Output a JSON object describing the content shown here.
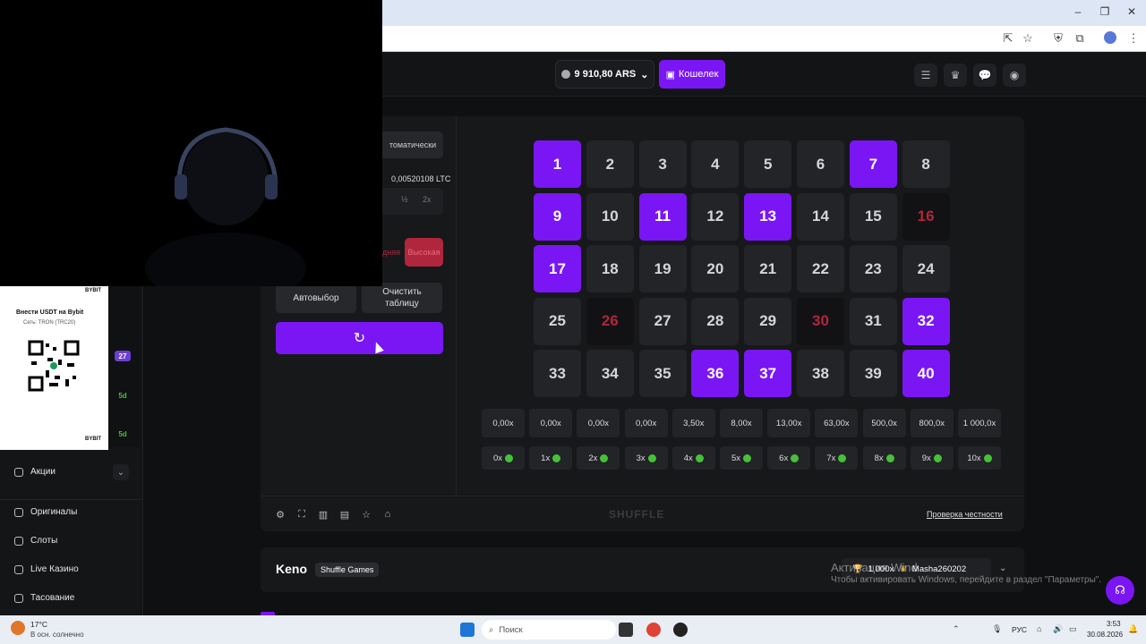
{
  "header": {
    "balance": "9 910,80 ARS",
    "wallet_label": "Кошелек"
  },
  "controls": {
    "mode_tab": "томатически",
    "bet_amount_crypto": "0,00520108 LTC",
    "half_label": "½",
    "double_label": "2x",
    "risk_medium": "дняя",
    "risk_high": "Высокая",
    "autoselect_label": "Автовыбор",
    "clear_label_1": "Очистить",
    "clear_label_2": "таблицу"
  },
  "grid": {
    "numbers": [
      1,
      2,
      3,
      4,
      5,
      6,
      7,
      8,
      9,
      10,
      11,
      12,
      13,
      14,
      15,
      16,
      17,
      18,
      19,
      20,
      21,
      22,
      23,
      24,
      25,
      26,
      27,
      28,
      29,
      30,
      31,
      32,
      33,
      34,
      35,
      36,
      37,
      38,
      39,
      40
    ],
    "selected": [
      1,
      7,
      9,
      11,
      13,
      17,
      32,
      36,
      37,
      40
    ],
    "hits_dark": [
      16,
      26,
      30
    ]
  },
  "payouts": [
    "0,00x",
    "0,00x",
    "0,00x",
    "0,00x",
    "3,50x",
    "8,00x",
    "13,00x",
    "63,00x",
    "500,0x",
    "800,0x",
    "1 000,0x"
  ],
  "hit_counts": [
    "0x",
    "1x",
    "2x",
    "3x",
    "4x",
    "5x",
    "6x",
    "7x",
    "8x",
    "9x",
    "10x"
  ],
  "footer": {
    "brand": "SHUFFLE",
    "fairness_label": "Проверка честности"
  },
  "info": {
    "game_title": "Keno",
    "provider": "Shuffle Games",
    "top_multiplier": "1 000x",
    "top_user": "Masha260202",
    "watermark_1": "Активация Wind",
    "watermark_2": "Чтобы активировать Windows, перейдите в раздел \"Параметры\"."
  },
  "sidebar": {
    "badge_27": "27",
    "badge_5d_1": "5d",
    "badge_5d_2": "5d",
    "promo": "Акции",
    "items": [
      "Оригиналы",
      "Слоты",
      "Live Казино",
      "Тасование"
    ]
  },
  "qr": {
    "title": "Внести USDT на Bybit",
    "network": "Сеть: TRON (TRC20)",
    "brand": "BYBIT"
  },
  "taskbar": {
    "search_placeholder": "Поиск",
    "weather_temp": "17°C",
    "weather_desc": "В осн. солнечно",
    "lang": "РУС",
    "time": "3:53",
    "date": "30.08.2026"
  },
  "colors": {
    "accent": "#7a16f4",
    "hit": "#b0263c",
    "gem": "#45c236"
  }
}
